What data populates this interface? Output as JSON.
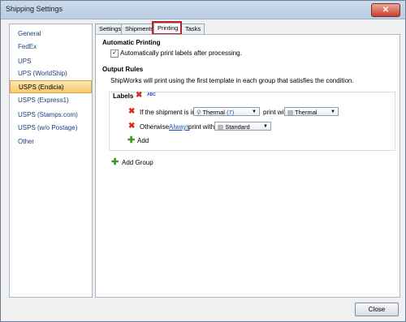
{
  "window": {
    "title": "Shipping Settings",
    "close_glyph": "✕"
  },
  "sidebar": {
    "items": [
      {
        "label": "General"
      },
      {
        "label": "FedEx"
      },
      {
        "label": "UPS"
      },
      {
        "label": "UPS (WorldShip)"
      },
      {
        "label": "USPS (Endicia)"
      },
      {
        "label": "USPS (Express1)"
      },
      {
        "label": "USPS (Stamps.com)"
      },
      {
        "label": "USPS (w/o Postage)"
      },
      {
        "label": "Other"
      }
    ],
    "selected_index": 4
  },
  "tabs": [
    {
      "label": "Settings"
    },
    {
      "label": "Shipments"
    },
    {
      "label": "Printing"
    },
    {
      "label": "Tasks"
    }
  ],
  "active_tab": "Printing",
  "printing": {
    "auto_heading": "Automatic Printing",
    "auto_checkbox_label": "Automatically print labels after processing.",
    "auto_checked": true,
    "rules_heading": "Output Rules",
    "rules_desc": "ShipWorks will print using the first template in each group that satisfies the condition.",
    "group_title": "Labels",
    "abc_tag": "ABC",
    "rule1": {
      "prefix": "If the shipment is in",
      "filter_value": "Thermal",
      "filter_count": "(7)",
      "mid": "print with",
      "template_value": "Thermal"
    },
    "rule2": {
      "prefix": "Otherwise",
      "link": "Always",
      "mid": "print with",
      "template_value": "Standard"
    },
    "add_label": "Add",
    "add_group_label": "Add Group"
  },
  "footer": {
    "close_label": "Close"
  },
  "icons": {
    "delete": "red-x",
    "add": "green-plus",
    "dropdown": "▼"
  }
}
